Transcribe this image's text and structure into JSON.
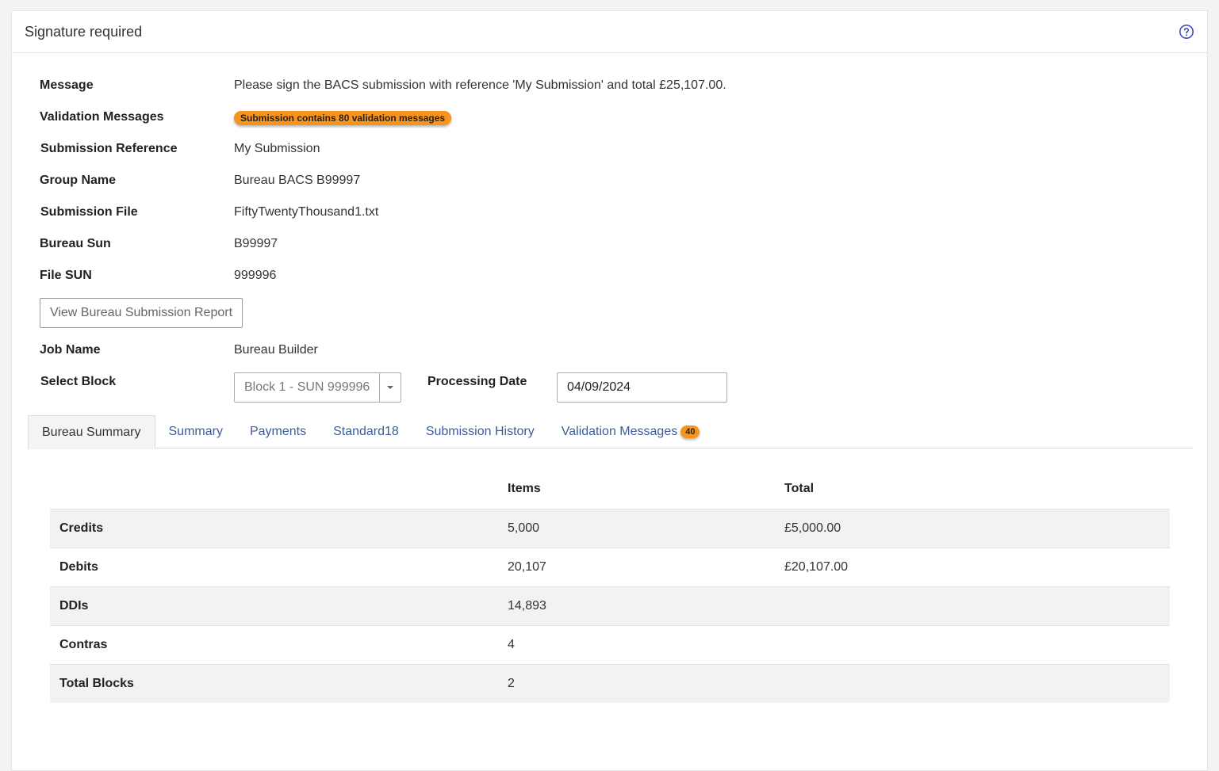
{
  "header": {
    "title": "Signature required",
    "help_icon": "question-circle-icon"
  },
  "details": {
    "message": {
      "label": "Message",
      "value": "Please sign the BACS submission with reference 'My Submission' and total £25,107.00."
    },
    "validation": {
      "label": "Validation Messages",
      "badge": "Submission contains 80 validation messages"
    },
    "submission_reference": {
      "label": "Submission Reference",
      "value": "My Submission"
    },
    "group_name": {
      "label": "Group Name",
      "value": "Bureau BACS B99997"
    },
    "submission_file": {
      "label": "Submission File",
      "value": "FiftyTwentyThousand1.txt"
    },
    "bureau_sun": {
      "label": "Bureau Sun",
      "value": "B99997"
    },
    "file_sun": {
      "label": "File SUN",
      "value": "999996"
    }
  },
  "report_button": {
    "label": "View Bureau Submission Report"
  },
  "job": {
    "label": "Job Name",
    "value": "Bureau Builder"
  },
  "block": {
    "label": "Select Block",
    "selected": "Block 1 - SUN 999996"
  },
  "processing_date": {
    "label": "Processing Date",
    "value": "04/09/2024"
  },
  "tabs": [
    {
      "label": "Bureau Summary"
    },
    {
      "label": "Summary"
    },
    {
      "label": "Payments"
    },
    {
      "label": "Standard18"
    },
    {
      "label": "Submission History"
    },
    {
      "label": "Validation Messages",
      "badge": "40"
    }
  ],
  "table": {
    "headers": [
      "",
      "Items",
      "Total"
    ],
    "rows": [
      {
        "label": "Credits",
        "items": "5,000",
        "total": "£5,000.00"
      },
      {
        "label": "Debits",
        "items": "20,107",
        "total": "£20,107.00"
      },
      {
        "label": "DDIs",
        "items": "14,893",
        "total": ""
      },
      {
        "label": "Contras",
        "items": "4",
        "total": ""
      },
      {
        "label": "Total Blocks",
        "items": "2",
        "total": ""
      }
    ]
  },
  "colors": {
    "badge": "#f7941d",
    "link": "#3f5c9a",
    "help_icon": "#3f51b5"
  }
}
